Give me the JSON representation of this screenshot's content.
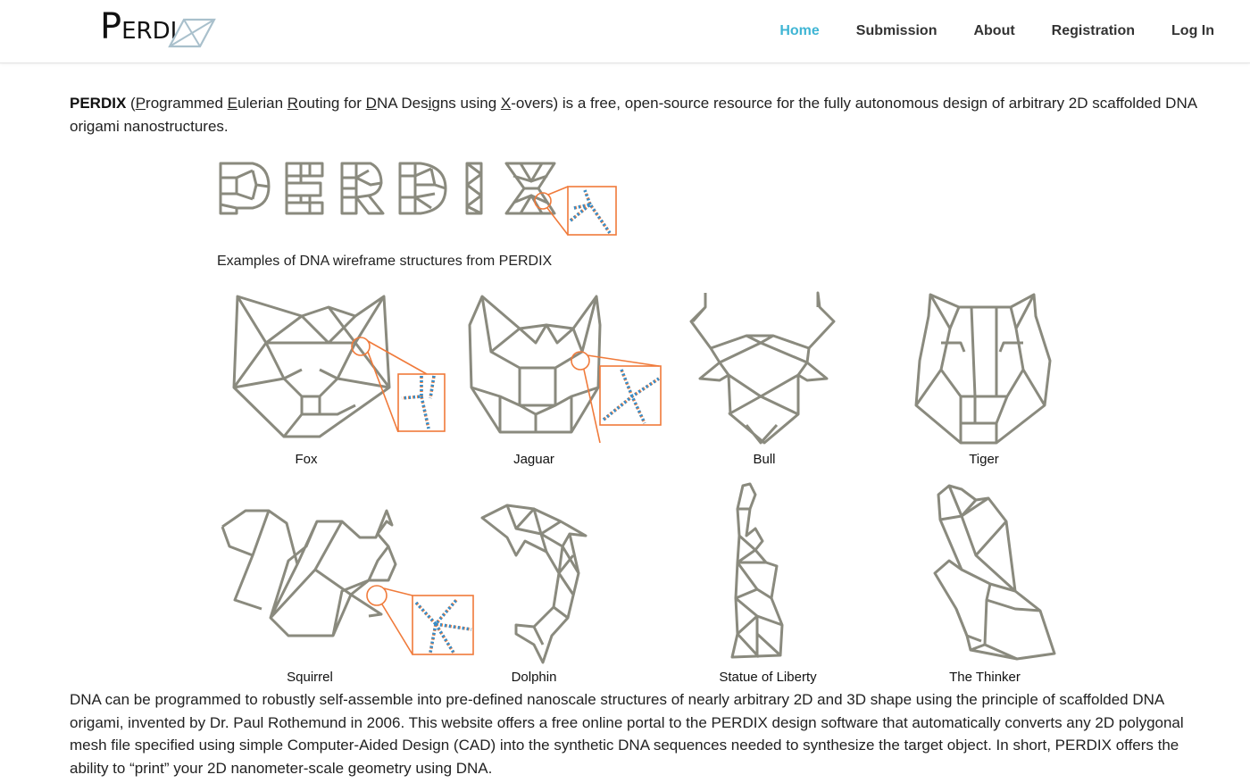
{
  "header": {
    "logo": {
      "text_big": "P",
      "text_rest": "ERDI",
      "icon": "wireframe-x-logo-icon"
    },
    "nav": [
      {
        "label": "Home",
        "active": true
      },
      {
        "label": "Submission",
        "active": false
      },
      {
        "label": "About",
        "active": false
      },
      {
        "label": "Registration",
        "active": false
      },
      {
        "label": "Log In",
        "active": false
      }
    ],
    "accent_color": "#3fb5d4"
  },
  "intro": {
    "brand": "PERDIX",
    "p1": " (",
    "u1": "P",
    "t1": "rogrammed ",
    "u2": "E",
    "t2": "ulerian ",
    "u3": "R",
    "t3": "outing for ",
    "u4": "D",
    "t4": "NA Des",
    "u5": "i",
    "t5": "gns using ",
    "u6": "X",
    "t6": "-overs) is a free, open-source resource for the fully autonomous design of arbitrary 2D scaffolded DNA origami nanostructures."
  },
  "figure": {
    "title_word": "PERDIX",
    "caption": "Examples of DNA wireframe structures from PERDIX",
    "examples": [
      {
        "label": "Fox",
        "has_zoom_inset": true
      },
      {
        "label": "Jaguar",
        "has_zoom_inset": true
      },
      {
        "label": "Bull",
        "has_zoom_inset": false
      },
      {
        "label": "Tiger",
        "has_zoom_inset": false
      },
      {
        "label": "Squirrel",
        "has_zoom_inset": true
      },
      {
        "label": "Dolphin",
        "has_zoom_inset": false
      },
      {
        "label": "Statue of Liberty",
        "has_zoom_inset": false
      },
      {
        "label": "The Thinker",
        "has_zoom_inset": false
      }
    ],
    "colors": {
      "wire": "#8a8a7e",
      "highlight": "#f07a3a",
      "strand": "#2f8fd0"
    }
  },
  "outro": {
    "text": "DNA can be programmed to robustly self-assemble into pre-defined nanoscale structures of nearly arbitrary 2D and 3D shape using the principle of scaffolded DNA origami, invented by Dr. Paul Rothemund in 2006. This website offers a free online portal to the PERDIX design software that automatically converts any 2D polygonal mesh file specified using simple Computer-Aided Design (CAD) into the synthetic DNA sequences needed to synthesize the target object. In short, PERDIX offers the ability to “print” your 2D nanometer-scale geometry using DNA."
  }
}
